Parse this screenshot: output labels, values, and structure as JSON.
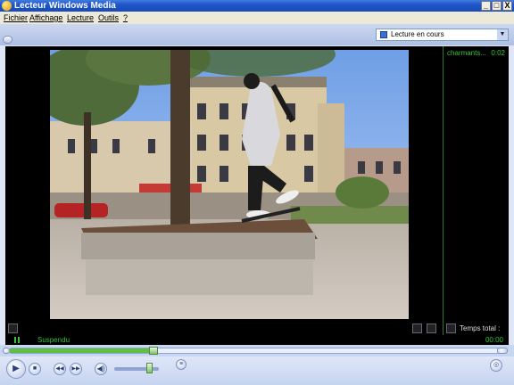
{
  "window": {
    "title": "Lecteur Windows Media"
  },
  "window_buttons": {
    "minimize": "_",
    "maximize": "□",
    "close": "X"
  },
  "menu": {
    "items": [
      "Fichier",
      "Affichage",
      "Lecture",
      "Outils",
      "?"
    ]
  },
  "playlist": {
    "selected": "Lecture en cours"
  },
  "now_playing": {
    "item": "charmants...",
    "item_time": "0:02",
    "total_label": "Temps total :"
  },
  "status": {
    "text": "Suspendu",
    "time": "00:00"
  },
  "seek": {
    "progress": 0.29
  },
  "volume": {
    "level": 0.78
  },
  "icons": {
    "play": "▶",
    "stop": "■",
    "prev": "◀◀",
    "next": "▶▶",
    "mute": "◀)",
    "eq": "≡",
    "compact": "◎"
  }
}
